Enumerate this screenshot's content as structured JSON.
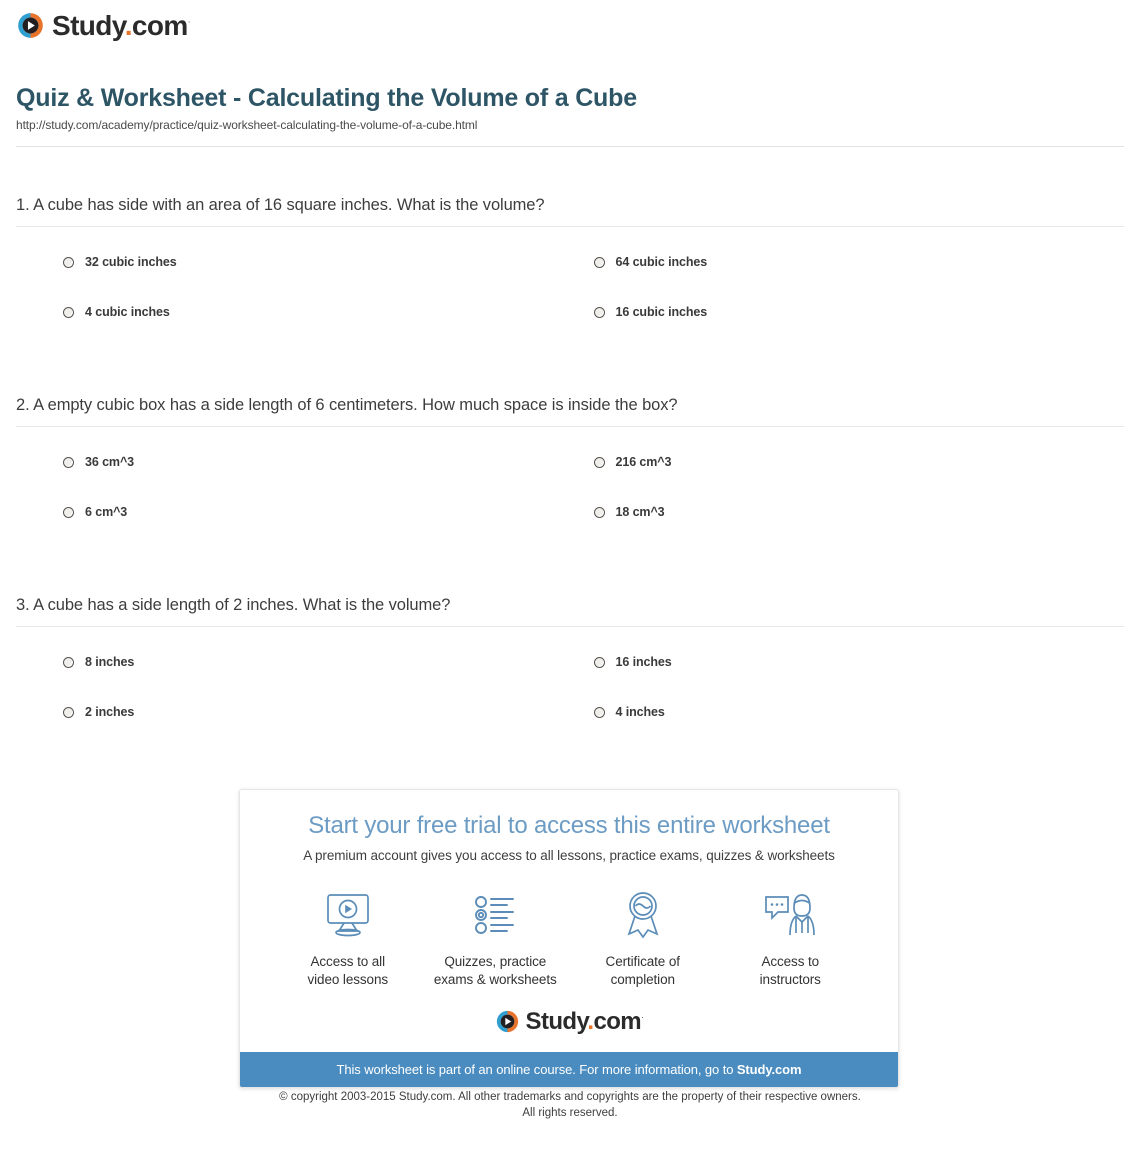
{
  "brand": {
    "name_main": "Study",
    "name_dot": ".",
    "name_tld": "com",
    "trademark": "·",
    "logo_blue": "#2f9fd0",
    "logo_orange": "#e8742c"
  },
  "header": {
    "title": "Quiz & Worksheet - Calculating the Volume of a Cube",
    "url": "http://study.com/academy/practice/quiz-worksheet-calculating-the-volume-of-a-cube.html",
    "title_color": "#2d5566"
  },
  "questions": [
    {
      "text": "1. A cube has side with an area of 16 square inches. What is the volume?",
      "options": [
        "32 cubic inches",
        "64 cubic inches",
        "4 cubic inches",
        "16 cubic inches"
      ]
    },
    {
      "text": "2. A empty cubic box has a side length of 6 centimeters. How much space is inside the box?",
      "options": [
        "36 cm^3",
        "216 cm^3",
        "6 cm^3",
        "18 cm^3"
      ]
    },
    {
      "text": "3. A cube has a side length of 2 inches. What is the volume?",
      "options": [
        "8 inches",
        "16 inches",
        "2 inches",
        "4 inches"
      ]
    }
  ],
  "promo": {
    "headline": "Start your free trial to access this entire worksheet",
    "headline_color": "#6c9bc4",
    "subhead": "A premium account gives you access to all lessons, practice exams, quizzes & worksheets",
    "features": [
      {
        "icon": "monitor-play-icon",
        "label_line1": "Access to all",
        "label_line2": "video lessons"
      },
      {
        "icon": "checklist-icon",
        "label_line1": "Quizzes, practice",
        "label_line2": "exams & worksheets"
      },
      {
        "icon": "award-ribbon-icon",
        "label_line1": "Certificate of",
        "label_line2": "completion"
      },
      {
        "icon": "instructor-chat-icon",
        "label_line1": "Access to",
        "label_line2": "instructors"
      }
    ],
    "bar_text": "This worksheet is part of an online course. For more information, go to ",
    "bar_link": "Study.com",
    "bar_color": "#4a8cc0"
  },
  "footer": {
    "copyright_line1": "© copyright 2003-2015 Study.com. All other trademarks and copyrights are the property of their respective owners.",
    "copyright_line2": "All rights reserved."
  }
}
